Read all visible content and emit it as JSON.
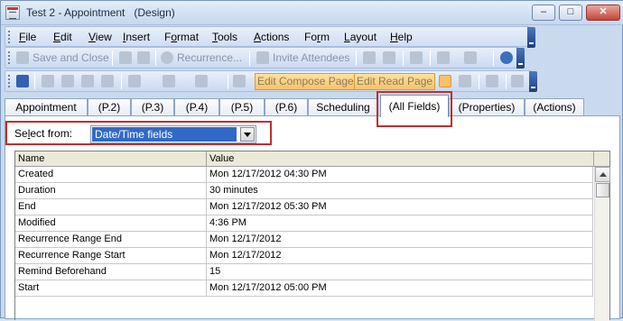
{
  "window": {
    "title": "Test 2 - Appointment   (Design)",
    "controls": {
      "minimize": "–",
      "maximize": "□",
      "close": "✕"
    }
  },
  "menubar": {
    "items": [
      {
        "underline": "F",
        "rest": "ile"
      },
      {
        "underline": "E",
        "rest": "dit"
      },
      {
        "underline": "V",
        "rest": "iew"
      },
      {
        "underline": "I",
        "rest": "nsert"
      },
      {
        "prefix": "F",
        "underline": "o",
        "rest": "rmat"
      },
      {
        "underline": "T",
        "rest": "ools"
      },
      {
        "underline": "A",
        "rest": "ctions"
      },
      {
        "prefix": "Fo",
        "underline": "r",
        "rest": "m"
      },
      {
        "underline": "L",
        "rest": "ayout"
      },
      {
        "underline": "H",
        "rest": "elp"
      }
    ]
  },
  "toolbar1": {
    "save_and_close": "Save and Close",
    "recurrence": "Recurrence...",
    "invite_attendees": "Invite Attendees"
  },
  "toolbar2": {
    "edit_compose_page": "Edit Compose Page",
    "edit_read_page": "Edit Read Page"
  },
  "tabs": [
    "Appointment",
    "(P.2)",
    "(P.3)",
    "(P.4)",
    "(P.5)",
    "(P.6)",
    "Scheduling",
    "(All Fields)",
    "(Properties)",
    "(Actions)"
  ],
  "active_tab": "(All Fields)",
  "select_from": {
    "label_prefix": "Se",
    "label_underline": "l",
    "label_rest": "ect from:",
    "value": "Date/Time fields"
  },
  "grid": {
    "columns": [
      "Name",
      "Value"
    ],
    "rows": [
      [
        "Created",
        "Mon 12/17/2012 04:30 PM"
      ],
      [
        "Duration",
        "30 minutes"
      ],
      [
        "End",
        "Mon 12/17/2012 05:30 PM"
      ],
      [
        "Modified",
        "4:36 PM"
      ],
      [
        "Recurrence Range End",
        "Mon 12/17/2012"
      ],
      [
        "Recurrence Range Start",
        "Mon 12/17/2012"
      ],
      [
        "Remind Beforehand",
        "15"
      ],
      [
        "Start",
        "Mon 12/17/2012 05:00 PM"
      ]
    ]
  },
  "colors": {
    "highlight_box": "#c22d2d",
    "selection": "#3169c6",
    "toolbar_active": "#f7c16a"
  }
}
